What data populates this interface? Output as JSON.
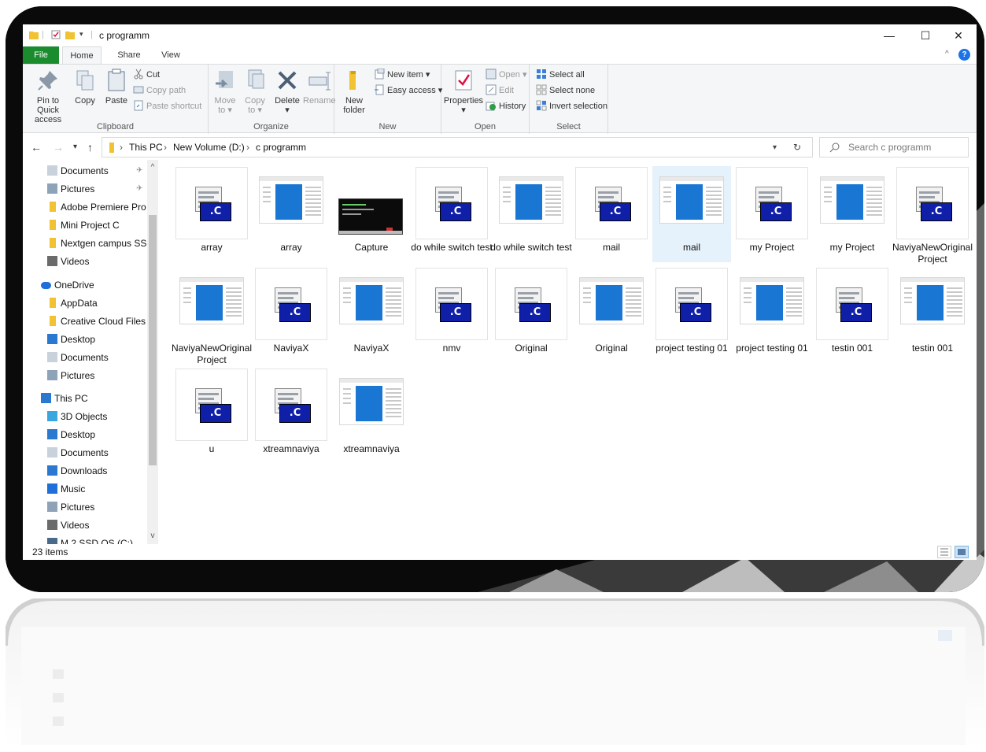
{
  "window": {
    "title": "c programm",
    "controls": {
      "minimize": "—",
      "maximize": "☐",
      "close": "✕"
    }
  },
  "ribbon": {
    "tabs": [
      "File",
      "Home",
      "Share",
      "View"
    ],
    "clipboard": {
      "label": "Clipboard",
      "pin": [
        "Pin to Quick",
        "access"
      ],
      "copy": "Copy",
      "paste": "Paste",
      "cut": "Cut",
      "copy_path": "Copy path",
      "paste_shortcut": "Paste shortcut"
    },
    "organize": {
      "label": "Organize",
      "move_to": [
        "Move",
        "to ▾"
      ],
      "copy_to": [
        "Copy",
        "to ▾"
      ],
      "delete": [
        "Delete",
        "▾"
      ],
      "rename": "Rename"
    },
    "new": {
      "label": "New",
      "new_folder": [
        "New",
        "folder"
      ],
      "new_item": "New item ▾",
      "easy_access": "Easy access ▾"
    },
    "open": {
      "label": "Open",
      "properties": [
        "Properties",
        "▾"
      ],
      "open": "Open ▾",
      "edit": "Edit",
      "history": "History"
    },
    "select": {
      "label": "Select",
      "select_all": "Select all",
      "select_none": "Select none",
      "invert_selection": "Invert selection"
    }
  },
  "address": {
    "crumbs": [
      "This PC",
      "New Volume (D:)",
      "c programm"
    ],
    "search_placeholder": "Search c programm"
  },
  "sidebar": [
    {
      "label": "Documents",
      "icon": "documents-icon",
      "pinned": true
    },
    {
      "label": "Pictures",
      "icon": "pictures-icon",
      "pinned": true
    },
    {
      "label": "Adobe Premiere Pro",
      "icon": "folder-icon"
    },
    {
      "label": "Mini Project C",
      "icon": "folder-icon"
    },
    {
      "label": "Nextgen campus SS",
      "icon": "folder-icon"
    },
    {
      "label": "Videos",
      "icon": "videos-icon"
    },
    {
      "label": "OneDrive",
      "icon": "onedrive-icon"
    },
    {
      "label": "AppData",
      "icon": "folder-icon"
    },
    {
      "label": "Creative Cloud Files",
      "icon": "folder-icon"
    },
    {
      "label": "Desktop",
      "icon": "desktop-icon"
    },
    {
      "label": "Documents",
      "icon": "documents-icon"
    },
    {
      "label": "Pictures",
      "icon": "pictures-icon"
    },
    {
      "label": "This PC",
      "icon": "pc-icon"
    },
    {
      "label": "3D Objects",
      "icon": "3d-objects-icon"
    },
    {
      "label": "Desktop",
      "icon": "desktop-icon"
    },
    {
      "label": "Documents",
      "icon": "documents-icon"
    },
    {
      "label": "Downloads",
      "icon": "downloads-icon"
    },
    {
      "label": "Music",
      "icon": "music-icon"
    },
    {
      "label": "Pictures",
      "icon": "pictures-icon"
    },
    {
      "label": "Videos",
      "icon": "videos-icon"
    },
    {
      "label": "M.2 SSD OS (C:)",
      "icon": "drive-icon"
    }
  ],
  "files": [
    {
      "name": "array",
      "kind": "dev"
    },
    {
      "name": "array",
      "kind": "window"
    },
    {
      "name": "Capture",
      "kind": "capture"
    },
    {
      "name": "do while switch test",
      "kind": "dev"
    },
    {
      "name": "do while switch test",
      "kind": "window"
    },
    {
      "name": "mail",
      "kind": "dev"
    },
    {
      "name": "mail",
      "kind": "window",
      "selected": true
    },
    {
      "name": "my Project",
      "kind": "dev"
    },
    {
      "name": "my Project",
      "kind": "window"
    },
    {
      "name": "NaviyaNewOriginalProject",
      "kind": "dev"
    },
    {
      "name": "NaviyaNewOriginalProject",
      "kind": "window"
    },
    {
      "name": "NaviyaX",
      "kind": "dev"
    },
    {
      "name": "NaviyaX",
      "kind": "window"
    },
    {
      "name": "nmv",
      "kind": "dev"
    },
    {
      "name": "Original",
      "kind": "dev"
    },
    {
      "name": "Original",
      "kind": "window"
    },
    {
      "name": "project testing 01",
      "kind": "dev"
    },
    {
      "name": "project testing 01",
      "kind": "window"
    },
    {
      "name": "testin 001",
      "kind": "dev"
    },
    {
      "name": "testin 001",
      "kind": "window"
    },
    {
      "name": "u",
      "kind": "dev"
    },
    {
      "name": "xtreamnaviya",
      "kind": "dev"
    },
    {
      "name": "xtreamnaviya",
      "kind": "window"
    }
  ],
  "dev_badge": ".C",
  "status": {
    "items": "23 items"
  },
  "colors": {
    "file_tab": "#1a8c2e",
    "selection": "#e5f1fb",
    "dev_blue": "#0f1fa8",
    "doc_blue": "#1976d2"
  }
}
